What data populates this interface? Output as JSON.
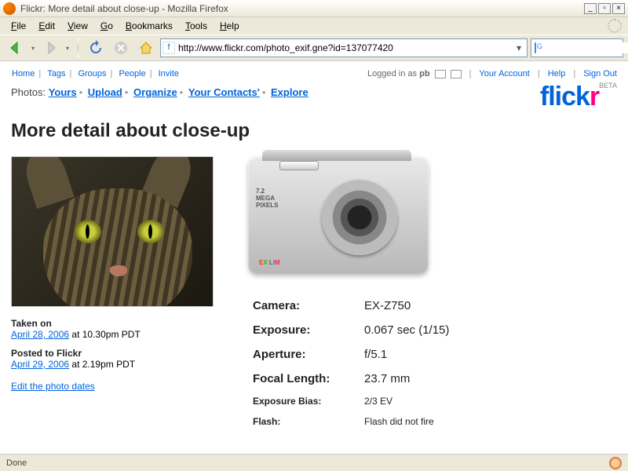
{
  "window": {
    "title": "Flickr: More detail about close-up - Mozilla Firefox"
  },
  "menubar": [
    "File",
    "Edit",
    "View",
    "Go",
    "Bookmarks",
    "Tools",
    "Help"
  ],
  "url": "http://www.flickr.com/photo_exif.gne?id=137077420",
  "search": "",
  "topnav": {
    "links": [
      "Home",
      "Tags",
      "Groups",
      "People",
      "Invite"
    ],
    "logged_in_prefix": "Logged in as ",
    "username": "pb",
    "right_links": [
      "Your Account",
      "Help",
      "Sign Out"
    ]
  },
  "subnav": {
    "label": "Photos:",
    "links": [
      "Yours",
      "Upload",
      "Organize",
      "Your Contacts'",
      "Explore"
    ]
  },
  "logo": {
    "left": "flick",
    "right": "r",
    "beta": "BETA"
  },
  "page_title": "More detail about close-up",
  "meta": {
    "taken_label": "Taken on",
    "taken_date": "April 28, 2006",
    "taken_time": " at 10.30pm PDT",
    "posted_label": "Posted to Flickr",
    "posted_date": "April 29, 2006",
    "posted_time": " at 2.19pm PDT",
    "edit_link": "Edit the photo dates"
  },
  "camera": {
    "mp": "7.2",
    "mp2": "MEGA",
    "mp3": "PIXELS"
  },
  "exif": {
    "rows": [
      {
        "k": "Camera:",
        "v": "EX-Z750",
        "minor": false
      },
      {
        "k": "Exposure:",
        "v": "0.067 sec (1/15)",
        "minor": false
      },
      {
        "k": "Aperture:",
        "v": "f/5.1",
        "minor": false
      },
      {
        "k": "Focal Length:",
        "v": "23.7 mm",
        "minor": false
      },
      {
        "k": "Exposure Bias:",
        "v": "2/3 EV",
        "minor": true
      },
      {
        "k": "Flash:",
        "v": "Flash did not fire",
        "minor": true
      }
    ]
  },
  "status": "Done"
}
